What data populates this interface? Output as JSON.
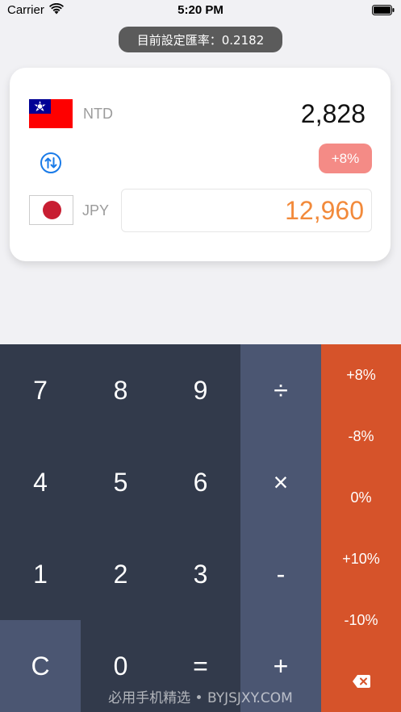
{
  "status_bar": {
    "carrier": "Carrier",
    "time": "5:20 PM"
  },
  "rate": {
    "label": "目前設定匯率：0.2182"
  },
  "converter": {
    "from": {
      "code": "NTD",
      "amount": "2,828",
      "flag": "taiwan-flag"
    },
    "to": {
      "code": "JPY",
      "amount": "12,960",
      "flag": "japan-flag"
    },
    "adjustment_badge": "+8%"
  },
  "keypad": {
    "digits": {
      "k7": "7",
      "k8": "8",
      "k9": "9",
      "k4": "4",
      "k5": "5",
      "k6": "6",
      "k1": "1",
      "k2": "2",
      "k3": "3",
      "k0": "0"
    },
    "clear": "C",
    "equals": "=",
    "ops": {
      "divide": "÷",
      "multiply": "×",
      "minus": "-",
      "plus": "+"
    },
    "percents": {
      "p_plus8": "+8%",
      "p_minus8": "-8%",
      "p_zero": "0%",
      "p_plus10": "+10%",
      "p_minus10": "-10%"
    },
    "backspace_icon": "backspace-icon"
  },
  "watermark": "必用手机精选 • BYJSJXY.COM",
  "colors": {
    "keypad_dark": "#323a4b",
    "keypad_slate": "#4b5672",
    "keypad_orange": "#d6532a",
    "jpy_amount": "#f28a3b",
    "badge": "#f48b86",
    "swap_icon": "#1a7be8"
  }
}
